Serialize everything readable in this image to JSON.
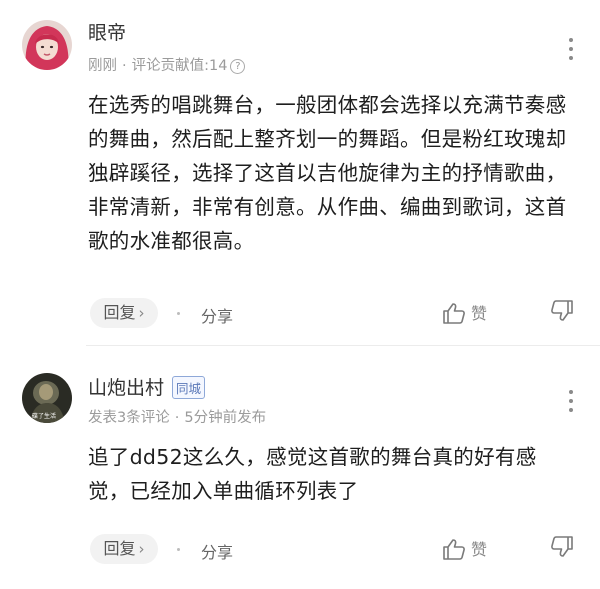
{
  "comments": [
    {
      "username": "眼帝",
      "meta_time": "刚刚",
      "meta_extra": "评论贡献值:14",
      "text": "在选秀的唱跳舞台，一般团体都会选择以充满节奏感的舞曲，然后配上整齐划一的舞蹈。但是粉红玫瑰却独辟蹊径，选择了这首以吉他旋律为主的抒情歌曲，非常清新，非常有创意。从作曲、编曲到歌词，这首歌的水准都很高。",
      "reply_label": "回复",
      "share_label": "分享",
      "like_label": "赞"
    },
    {
      "username": "山炮出村",
      "badge": "同城",
      "meta_time": "发表3条评论",
      "meta_extra": "5分钟前发布",
      "text": "追了dd52这么久，感觉这首歌的舞台真的好有感觉，已经加入单曲循环列表了",
      "reply_label": "回复",
      "share_label": "分享",
      "like_label": "赞",
      "avatar_caption": "碟了生活"
    }
  ],
  "icons": {
    "chevron": "chevron-right-icon",
    "info": "info-icon",
    "more": "more-vertical-icon",
    "like": "thumbs-up-icon",
    "dislike": "thumbs-down-icon"
  },
  "colors": {
    "badge_border": "#8ea8d8",
    "badge_text": "#5a78b8",
    "meta": "#9b9b9b"
  }
}
